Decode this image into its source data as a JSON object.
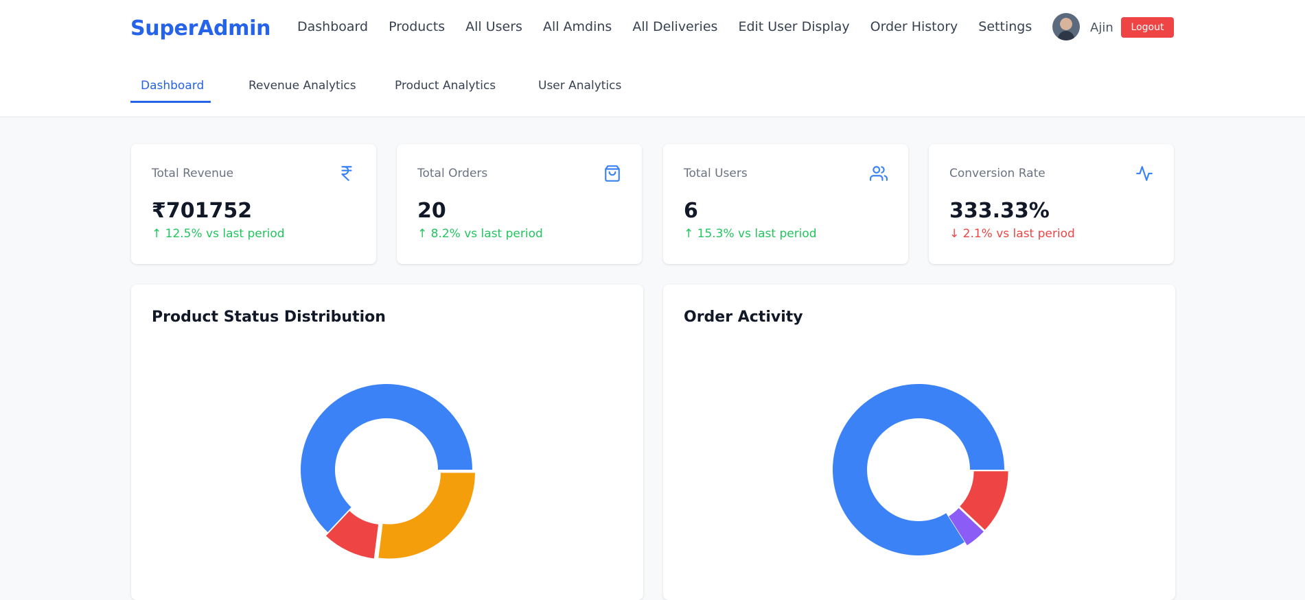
{
  "header": {
    "brand": "SuperAdmin",
    "nav": [
      "Dashboard",
      "Products",
      "All Users",
      "All Amdins",
      "All Deliveries",
      "Edit User Display",
      "Order History",
      "Settings"
    ],
    "user_name": "Ajin",
    "logout_label": "Logout"
  },
  "subtabs": {
    "items": [
      "Dashboard",
      "Revenue Analytics",
      "Product Analytics",
      "User Analytics"
    ],
    "active": "Dashboard"
  },
  "stats": [
    {
      "label": "Total Revenue",
      "value": "₹701752",
      "trend": "↑ 12.5% vs last period",
      "direction": "up",
      "icon": "rupee-icon"
    },
    {
      "label": "Total Orders",
      "value": "20",
      "trend": "↑ 8.2% vs last period",
      "direction": "up",
      "icon": "shopping-bag-icon"
    },
    {
      "label": "Total Users",
      "value": "6",
      "trend": "↑ 15.3% vs last period",
      "direction": "up",
      "icon": "users-icon"
    },
    {
      "label": "Conversion Rate",
      "value": "333.33%",
      "trend": "↓ 2.1% vs last period",
      "direction": "down",
      "icon": "activity-icon"
    }
  ],
  "colors": {
    "accent": "#2563eb",
    "up": "#22c55e",
    "down": "#ef4444",
    "blue": "#3b82f6",
    "red": "#ef4444",
    "amber": "#f59e0b",
    "purple": "#8b5cf6"
  },
  "chart_data": [
    {
      "type": "pie",
      "title": "Product Status Distribution",
      "values": [
        63,
        10,
        27
      ],
      "colors": [
        "#3b82f6",
        "#ef4444",
        "#f59e0b"
      ]
    },
    {
      "type": "pie",
      "title": "Order Activity",
      "values": [
        84,
        4,
        12
      ],
      "colors": [
        "#3b82f6",
        "#8b5cf6",
        "#ef4444"
      ]
    }
  ]
}
